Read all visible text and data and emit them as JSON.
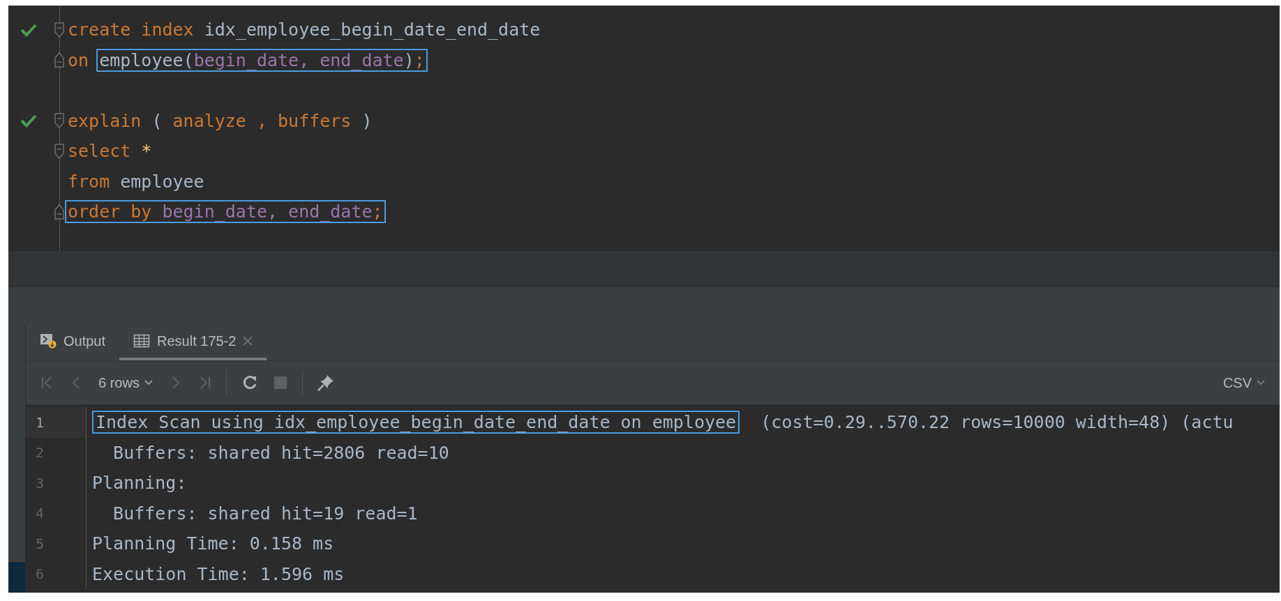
{
  "editor": {
    "lines": [
      {
        "check": true,
        "fold_start": true,
        "fold_end": false,
        "segments": [
          {
            "boxed": false,
            "tokens": [
              {
                "kind": "keyword",
                "text": "create index "
              },
              {
                "kind": "ident",
                "text": "idx_employee_begin_date_end_date"
              }
            ]
          }
        ]
      },
      {
        "check": false,
        "fold_start": false,
        "fold_end": true,
        "segments": [
          {
            "boxed": false,
            "tokens": [
              {
                "kind": "keyword",
                "text": "on "
              }
            ]
          },
          {
            "boxed": true,
            "tokens": [
              {
                "kind": "ident",
                "text": "employee("
              },
              {
                "kind": "column",
                "text": "begin_date, end_date"
              },
              {
                "kind": "ident",
                "text": ")"
              },
              {
                "kind": "keyword",
                "text": ";"
              }
            ]
          }
        ]
      },
      {
        "check": false,
        "fold_start": false,
        "fold_end": false
      },
      {
        "check": true,
        "fold_start": true,
        "fold_end": false,
        "segments": [
          {
            "boxed": false,
            "tokens": [
              {
                "kind": "keyword",
                "text": "explain "
              },
              {
                "kind": "ident",
                "text": "( "
              },
              {
                "kind": "keyword",
                "text": "analyze , buffers "
              },
              {
                "kind": "ident",
                "text": ")"
              }
            ]
          }
        ]
      },
      {
        "check": false,
        "fold_start": true,
        "fold_end": false,
        "segments": [
          {
            "boxed": false,
            "tokens": [
              {
                "kind": "keyword",
                "text": "select "
              },
              {
                "kind": "star",
                "text": "*"
              }
            ]
          }
        ]
      },
      {
        "check": false,
        "fold_start": false,
        "fold_end": false,
        "segments": [
          {
            "boxed": false,
            "tokens": [
              {
                "kind": "keyword",
                "text": "from "
              },
              {
                "kind": "ident",
                "text": "employee"
              }
            ]
          }
        ]
      },
      {
        "check": false,
        "fold_start": false,
        "fold_end": true,
        "segments": [
          {
            "boxed": true,
            "tokens": [
              {
                "kind": "keyword",
                "text": "order by "
              },
              {
                "kind": "column",
                "text": "begin_date, end_date"
              },
              {
                "kind": "keyword",
                "text": ";"
              }
            ]
          }
        ]
      }
    ]
  },
  "results": {
    "tabs": [
      {
        "kind": "console",
        "label": "Output",
        "selected": false,
        "closable": false
      },
      {
        "kind": "table",
        "label": "Result 175-2",
        "selected": true,
        "closable": true
      }
    ],
    "toolbar": {
      "row_count": "6 rows",
      "format": "CSV"
    },
    "rows": [
      {
        "number": "1",
        "current": true,
        "boxed": "Index Scan using idx_employee_begin_date_end_date on employee",
        "text": "  (cost=0.29..570.22 rows=10000 width=48) (actu"
      },
      {
        "number": "2",
        "current": false,
        "text": "  Buffers: shared hit=2806 read=10"
      },
      {
        "number": "3",
        "current": false,
        "text": "Planning:"
      },
      {
        "number": "4",
        "current": false,
        "text": "  Buffers: shared hit=19 read=1"
      },
      {
        "number": "5",
        "current": false,
        "text": "Planning Time: 0.158 ms"
      },
      {
        "number": "6",
        "current": false,
        "text": "Execution Time: 1.596 ms"
      }
    ]
  }
}
